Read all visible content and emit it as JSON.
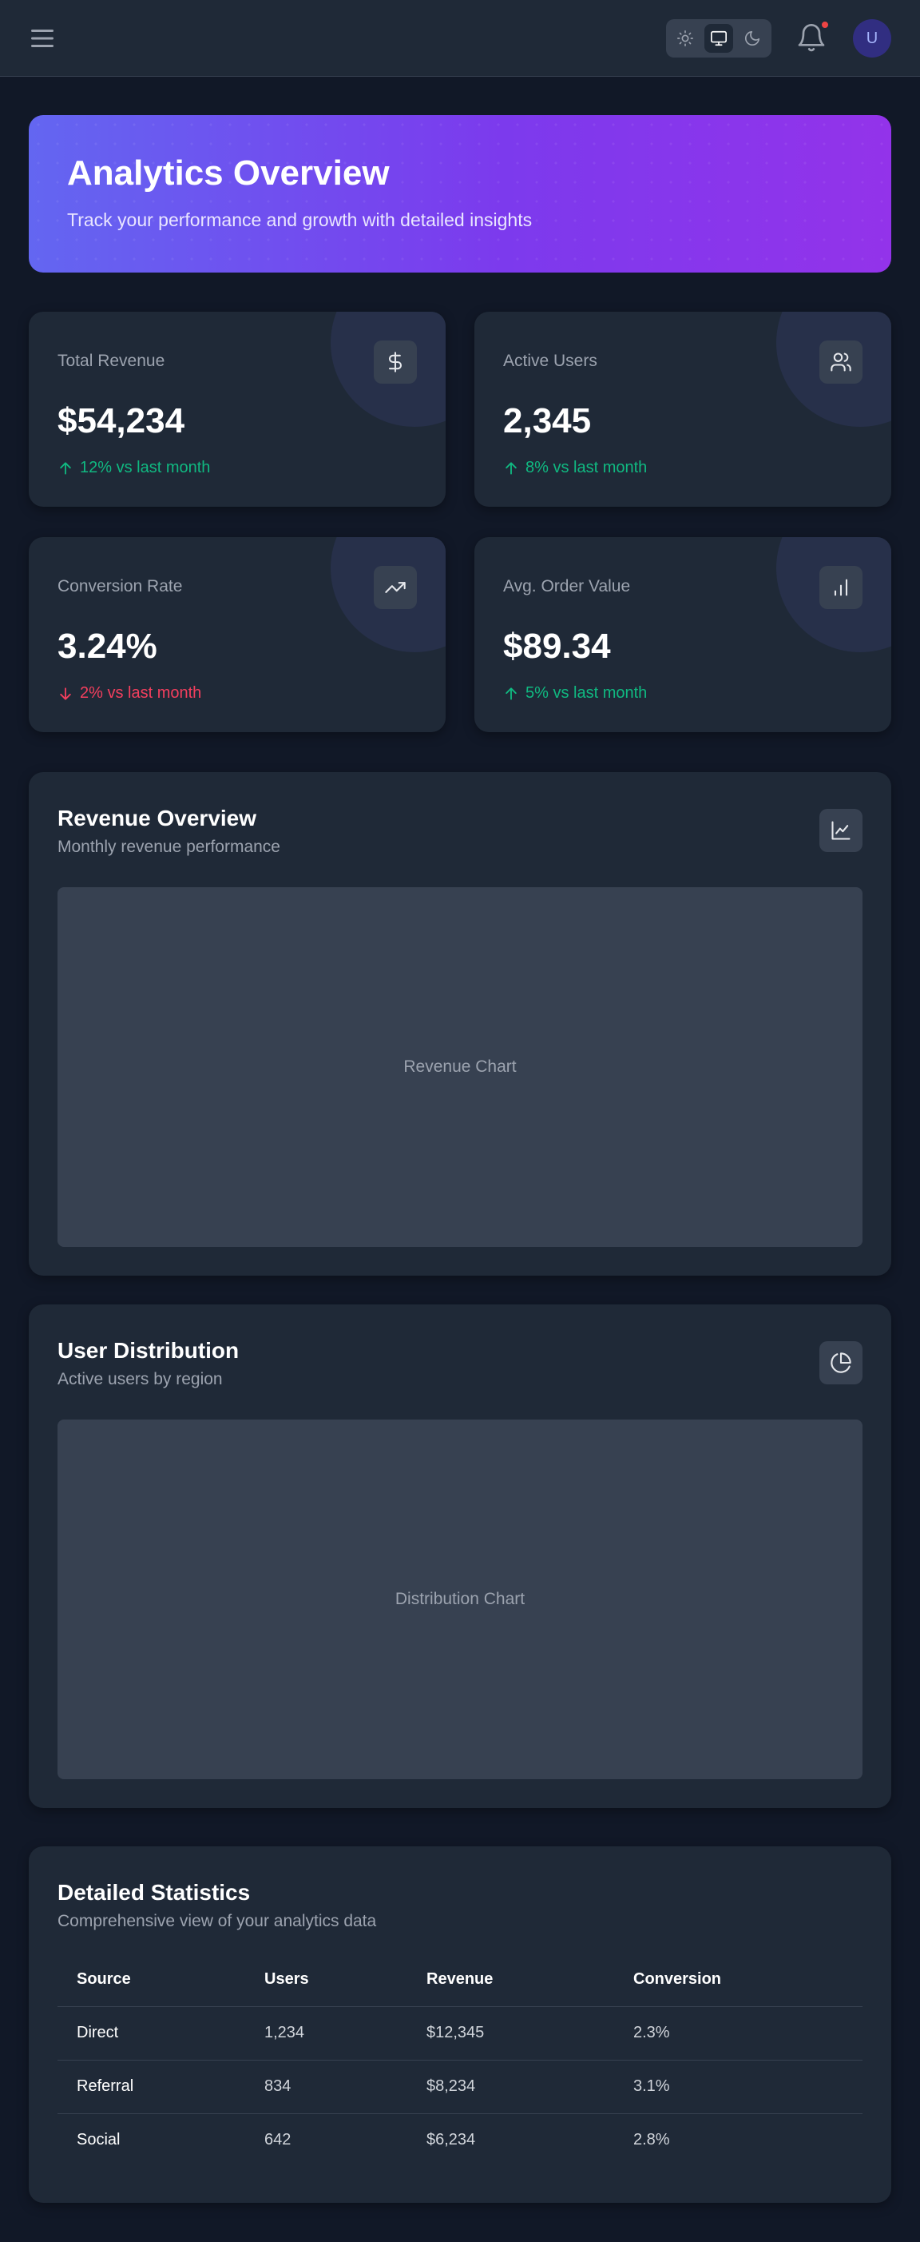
{
  "header": {
    "avatar_initial": "U",
    "theme_options": [
      "light",
      "system",
      "dark"
    ],
    "active_theme": "system",
    "has_notification": true
  },
  "hero": {
    "title": "Analytics Overview",
    "subtitle": "Track your performance and growth with detailed insights"
  },
  "stats": [
    {
      "label": "Total Revenue",
      "value": "$54,234",
      "change": "12% vs last month",
      "trend": "up",
      "icon": "dollar-icon"
    },
    {
      "label": "Active Users",
      "value": "2,345",
      "change": "8% vs last month",
      "trend": "up",
      "icon": "users-icon"
    },
    {
      "label": "Conversion Rate",
      "value": "3.24%",
      "change": "2% vs last month",
      "trend": "down",
      "icon": "trending-up-icon"
    },
    {
      "label": "Avg. Order Value",
      "value": "$89.34",
      "change": "5% vs last month",
      "trend": "up",
      "icon": "bar-chart-icon"
    }
  ],
  "revenue_panel": {
    "title": "Revenue Overview",
    "subtitle": "Monthly revenue performance",
    "placeholder": "Revenue Chart",
    "icon": "line-chart-icon"
  },
  "distribution_panel": {
    "title": "User Distribution",
    "subtitle": "Active users by region",
    "placeholder": "Distribution Chart",
    "icon": "pie-chart-icon"
  },
  "table_panel": {
    "title": "Detailed Statistics",
    "subtitle": "Comprehensive view of your analytics data",
    "columns": [
      "Source",
      "Users",
      "Revenue",
      "Conversion"
    ],
    "rows": [
      [
        "Direct",
        "1,234",
        "$12,345",
        "2.3%"
      ],
      [
        "Referral",
        "834",
        "$8,234",
        "3.1%"
      ],
      [
        "Social",
        "642",
        "$6,234",
        "2.8%"
      ]
    ]
  },
  "colors": {
    "background": "#111827",
    "surface": "#1f2937",
    "hero_gradient_start": "#6366f1",
    "hero_gradient_end": "#9333ea",
    "positive": "#10b981",
    "negative": "#f43f5e",
    "notification": "#ef4444"
  }
}
